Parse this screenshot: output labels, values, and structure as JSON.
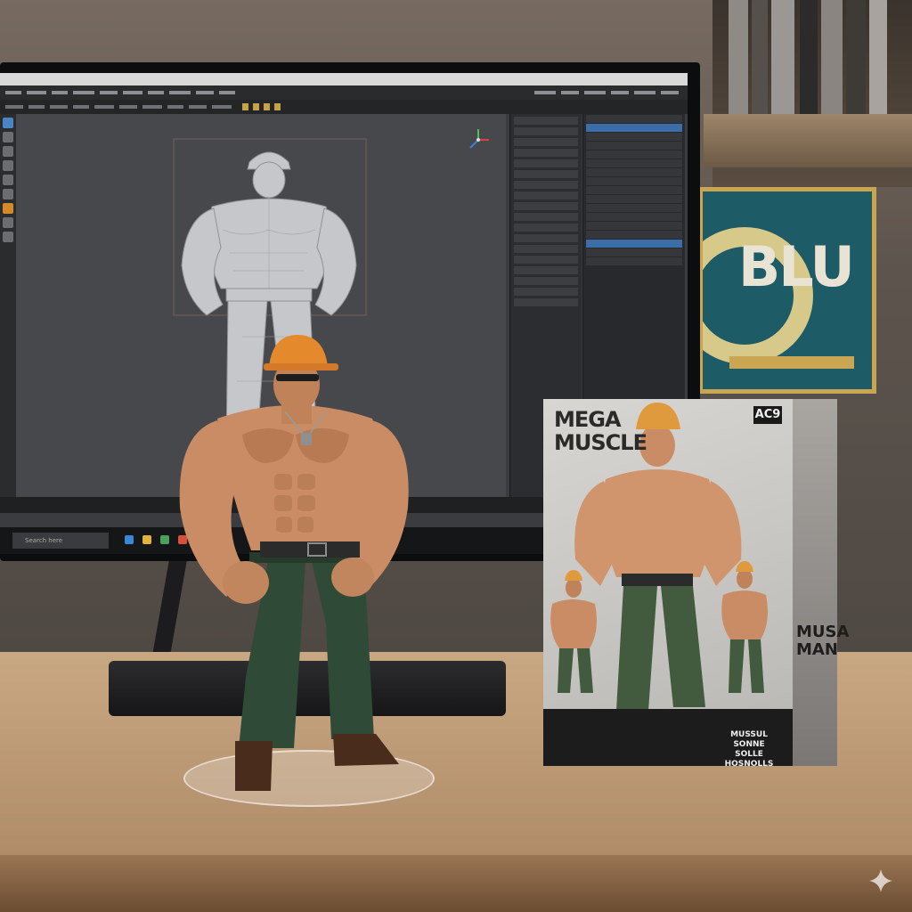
{
  "scene": {
    "description_tag": "figurine-product-photo",
    "figure": {
      "box": {
        "title_line1": "MEGA",
        "title_line2": "MUSCLE",
        "badge": "AC9",
        "side_title": "MUSA MAN",
        "bottom_logo": "MUSSUL SONNE SOLLE HOSNOLLS"
      },
      "poster_text": "BLU"
    },
    "software_window": {
      "search_placeholder": "Search here"
    },
    "colors": {
      "hard_hat": "#e58a2c",
      "pants": "#2f4a36",
      "skin": "#c98c64",
      "poster_bg": "#1d5b66",
      "poster_border": "#caa552",
      "selection": "#3b6ea8"
    }
  }
}
